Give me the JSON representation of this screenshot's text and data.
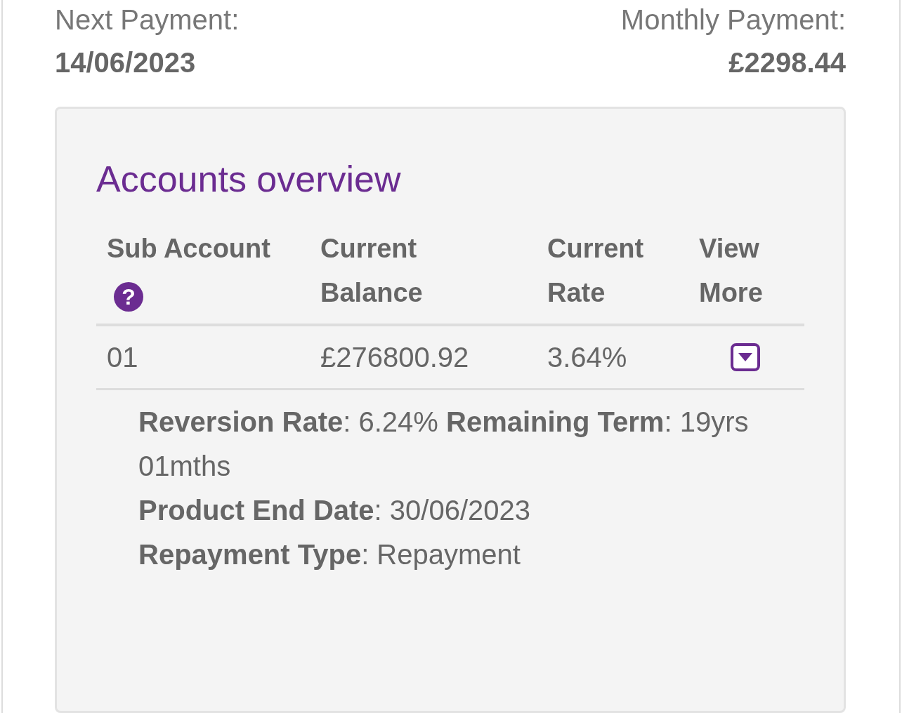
{
  "summary": [
    {
      "label": "Next Payment:",
      "value": "14/06/2023"
    },
    {
      "label": "Monthly Payment:",
      "value": "£2298.44"
    }
  ],
  "accounts": {
    "title": "Accounts overview",
    "columns": [
      {
        "label": "Sub Account",
        "help": "?"
      },
      {
        "label": "Current Balance"
      },
      {
        "label": "Current Rate"
      },
      {
        "label": "View More"
      }
    ],
    "rows": [
      {
        "sub_account": "01",
        "balance": "£276800.92",
        "rate": "3.64%",
        "expanded": true,
        "details": [
          "**Reversion Rate**: 6.24% **Remaining Term**: 19yrs 01mths",
          "**Product End Date**: 30/06/2023",
          "**Repayment Type**: Repayment"
        ]
      }
    ]
  }
}
